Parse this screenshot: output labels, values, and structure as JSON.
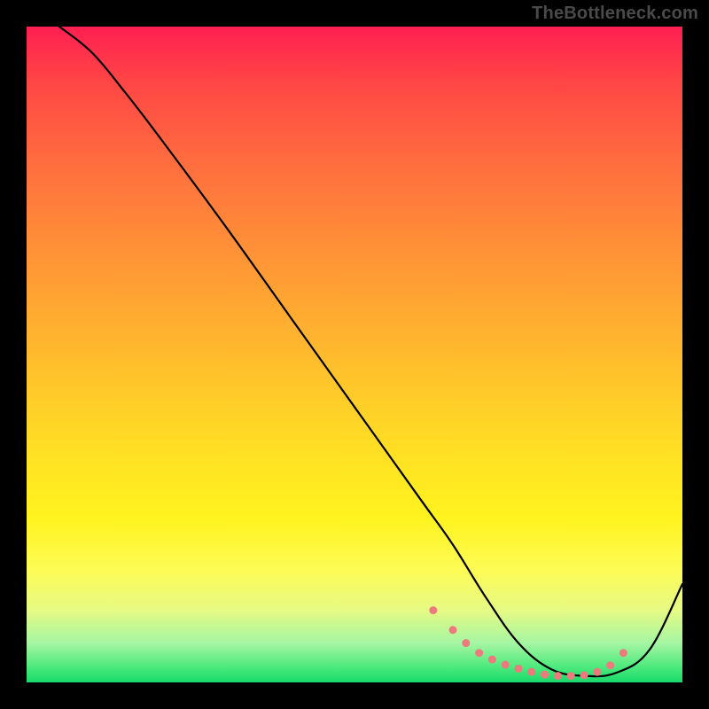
{
  "attribution": "TheBottleneck.com",
  "chart_data": {
    "type": "line",
    "title": "",
    "xlabel": "",
    "ylabel": "",
    "xlim": [
      0,
      100
    ],
    "ylim": [
      0,
      100
    ],
    "series": [
      {
        "name": "curve",
        "x": [
          5,
          10,
          15,
          20,
          30,
          40,
          50,
          60,
          65,
          70,
          75,
          80,
          85,
          90,
          95,
          100
        ],
        "values": [
          100,
          96,
          90,
          83.5,
          70,
          56,
          42,
          28,
          21,
          13,
          6,
          2,
          1,
          1.5,
          5,
          15
        ]
      }
    ],
    "markers": {
      "name": "highlighted-band",
      "color": "#ed7b7d",
      "x": [
        62,
        65,
        67,
        69,
        71,
        73,
        75,
        77,
        79,
        81,
        83,
        85,
        87,
        89,
        91
      ],
      "values": [
        11,
        8,
        6,
        4.5,
        3.5,
        2.7,
        2.1,
        1.6,
        1.2,
        1,
        1,
        1.1,
        1.6,
        2.6,
        4.5
      ]
    },
    "background": "vertical-heat-gradient"
  }
}
